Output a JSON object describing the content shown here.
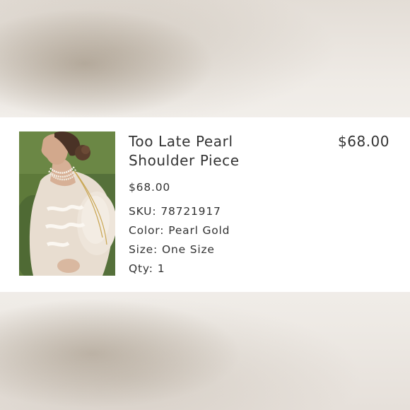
{
  "product": {
    "name": "Too Late Pearl Shoulder Piece",
    "name_line1": "Too Late Pearl",
    "name_line2": "Shoulder Piece",
    "unit_price": "$68.00",
    "total_price": "$68.00",
    "details": [
      {
        "label": "SKU:",
        "value": "78721917"
      },
      {
        "label": "Color:",
        "value": "Pearl Gold"
      },
      {
        "label": "Size:",
        "value": "One Size"
      },
      {
        "label": "Qty:",
        "value": "1"
      }
    ]
  }
}
